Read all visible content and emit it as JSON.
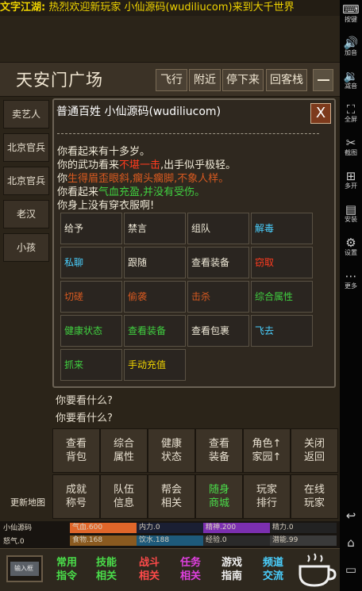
{
  "marquee": {
    "prefix": "文字江湖:",
    "text": "热烈欢迎新玩家 小仙源码(wudiliucom)来到大千世界"
  },
  "location": {
    "title": "天安门广场",
    "buttons": [
      "飞行",
      "附近",
      "停下来",
      "回客栈"
    ]
  },
  "npcs": [
    "卖艺人",
    "北京官兵",
    "北京官兵",
    "老汉",
    "小孩"
  ],
  "chat": {
    "partial": "...",
    "lines": [
      "你要看什么?",
      "你要看什么?"
    ]
  },
  "actions": {
    "row1": [
      "查看\n背包",
      "综合\n属性",
      "健康\n状态",
      "查看\n装备",
      "角色↑\n家园↑",
      "关闭\n返回"
    ],
    "row2": [
      "成就\n称号",
      "队伍\n信息",
      "帮会\n相关",
      "随身\n商城",
      "玩家\n排行",
      "在线\n玩家"
    ],
    "new_map": "更新地图"
  },
  "stats": {
    "name": "小仙源码",
    "nuqi": "怒气.0",
    "qixue": {
      "text": "气血.600",
      "color": "#e0662a"
    },
    "neili": {
      "text": "内力.0",
      "color": "#1e3a8c"
    },
    "jingshen": {
      "text": "精神.200",
      "color": "#7b2fb0"
    },
    "jingli": {
      "text": "精力.0",
      "color": "#5a5a5a"
    },
    "shiwu": {
      "text": "食物.168",
      "color": "#8a5a20"
    },
    "yinshui": {
      "text": "饮水.188",
      "color": "#1e5a7a"
    },
    "jingyan": {
      "text": "经验.0",
      "color": "#3a3a3a"
    },
    "qianneng": {
      "text": "潜能.99",
      "color": "#4a4a4a"
    }
  },
  "bottom_nav": {
    "input": "输入框",
    "items": [
      {
        "label": "常用\n指令",
        "color": "#4ade4a"
      },
      {
        "label": "技能\n相关",
        "color": "#4ade4a"
      },
      {
        "label": "战斗\n相关",
        "color": "#ff4a4a"
      },
      {
        "label": "任务\n相关",
        "color": "#e040e0"
      },
      {
        "label": "游戏\n指南",
        "color": "#f0f0f0"
      },
      {
        "label": "频道\n交流",
        "color": "#4ad0ff"
      }
    ]
  },
  "modal": {
    "title": "普通百姓 小仙源码(wudiliucom)",
    "close": "X",
    "rule": "——————————————————————",
    "desc": {
      "line1": "你看起来有十多岁。",
      "line2_a": "你的武功看来",
      "line2_b": "不堪一击",
      "line2_c": ",出手似乎极轻。",
      "line3_a": "你",
      "line3_b": "生得眉歪眼斜,瘸头瘸脚,不象人样。",
      "line4_a": "你看起来",
      "line4_b": "气血充盈,并没有受伤。",
      "line5": "你身上没有穿衣服啊!"
    },
    "buttons": [
      {
        "label": "给予",
        "color": "#f0ead8"
      },
      {
        "label": "禁言",
        "color": "#f0ead8"
      },
      {
        "label": "组队",
        "color": "#f0ead8"
      },
      {
        "label": "解毒",
        "color": "#4ad0ff"
      },
      {
        "label": "私聊",
        "color": "#4ad0ff"
      },
      {
        "label": "跟随",
        "color": "#f0ead8"
      },
      {
        "label": "查看装备",
        "color": "#f0ead8"
      },
      {
        "label": "窃取",
        "color": "#ff3b1f"
      },
      {
        "label": "切磋",
        "color": "#d85a20"
      },
      {
        "label": "偷袭",
        "color": "#d85a20"
      },
      {
        "label": "击杀",
        "color": "#d85a20"
      },
      {
        "label": "综合属性",
        "color": "#40d040"
      },
      {
        "label": "健康状态",
        "color": "#40d040"
      },
      {
        "label": "查看装备",
        "color": "#40d040"
      },
      {
        "label": "查看包裹",
        "color": "#f0ead8"
      },
      {
        "label": "飞去",
        "color": "#4ad0ff"
      },
      {
        "label": "抓来",
        "color": "#40d040"
      },
      {
        "label": "手动充值",
        "color": "#f0d400"
      }
    ]
  },
  "sysbar": [
    {
      "icon": "⌨",
      "label": "按键"
    },
    {
      "icon": "🔊",
      "label": "加音"
    },
    {
      "icon": "🔉",
      "label": "减音"
    },
    {
      "icon": "⛶",
      "label": "全屏"
    },
    {
      "icon": "✂",
      "label": "截图"
    },
    {
      "icon": "⊞",
      "label": "多开"
    },
    {
      "icon": "▤",
      "label": "安装"
    },
    {
      "icon": "⚙",
      "label": "设置"
    },
    {
      "icon": "⋯",
      "label": "更多"
    },
    {
      "icon": "↩",
      "label": ""
    },
    {
      "icon": "⌂",
      "label": ""
    },
    {
      "icon": "▭",
      "label": ""
    }
  ]
}
